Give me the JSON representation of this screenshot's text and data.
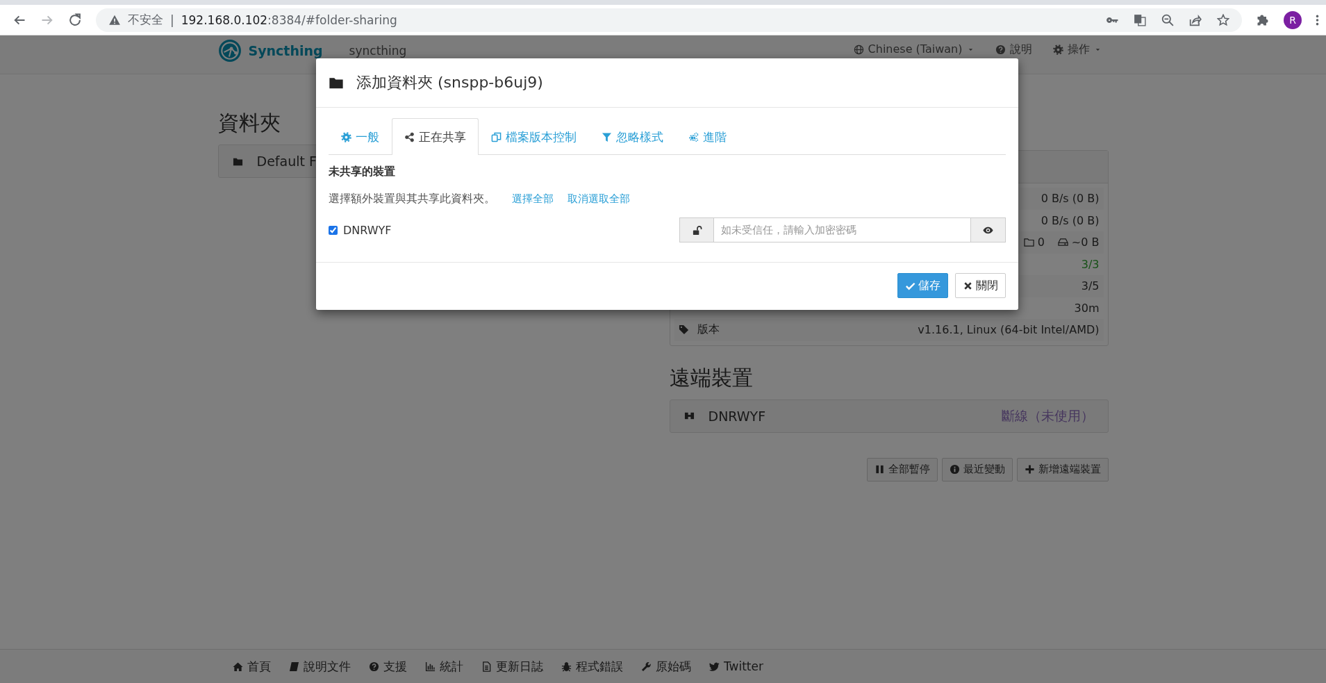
{
  "browser": {
    "security_label": "不安全",
    "separator": "|",
    "url_host": "192.168.0.102",
    "url_path": ":8384/#folder-sharing",
    "profile_initial": "R"
  },
  "navbar": {
    "brand": "Syncthing",
    "device_name": "syncthing",
    "items": [
      {
        "label": "Chinese (Taiwan)",
        "dropdown": true
      },
      {
        "label": "說明",
        "dropdown": false
      },
      {
        "label": "操作",
        "dropdown": true
      }
    ]
  },
  "folders": {
    "heading": "資料夾",
    "items": [
      {
        "name": "Default F"
      }
    ]
  },
  "this_device": {
    "rows": [
      {
        "kind": "plain",
        "value": "0 B/s (0 B)"
      },
      {
        "kind": "plain",
        "value": "0 B/s (0 B)"
      },
      {
        "kind": "counts",
        "folders": "0",
        "size": "~0 B"
      },
      {
        "kind": "ok",
        "value": "3/3"
      },
      {
        "kind": "plain",
        "value": "3/5"
      },
      {
        "kind": "plain",
        "value": "30m"
      },
      {
        "kind": "labeled",
        "label": "版本",
        "value": "v1.16.1, Linux (64-bit Intel/AMD)"
      }
    ]
  },
  "remote_devices": {
    "heading": "遠端裝置",
    "items": [
      {
        "name": "DNRWYF",
        "status": "斷線（未使用）"
      }
    ],
    "buttons": [
      "全部暫停",
      "最近變動",
      "新增遠端裝置"
    ]
  },
  "modal": {
    "title": "添加資料夾 (snspp-b6uj9)",
    "tabs": [
      {
        "label": "一般",
        "selected": false
      },
      {
        "label": "正在共享",
        "selected": true
      },
      {
        "label": "檔案版本控制",
        "selected": false
      },
      {
        "label": "忽略樣式",
        "selected": false
      },
      {
        "label": "進階",
        "selected": false
      }
    ],
    "section_title": "未共享的裝置",
    "description": "選擇額外裝置與其共享此資料夾。",
    "links": [
      "選擇全部",
      "取消選取全部"
    ],
    "devices": [
      {
        "name": "DNRWYF",
        "checked": true,
        "password_placeholder": "如未受信任，請輸入加密密碼"
      }
    ],
    "buttons": [
      "儲存",
      "關閉"
    ]
  },
  "footer": {
    "links": [
      "首頁",
      "說明文件",
      "支援",
      "統計",
      "更新日誌",
      "程式錯誤",
      "原始碼",
      "Twitter"
    ]
  }
}
